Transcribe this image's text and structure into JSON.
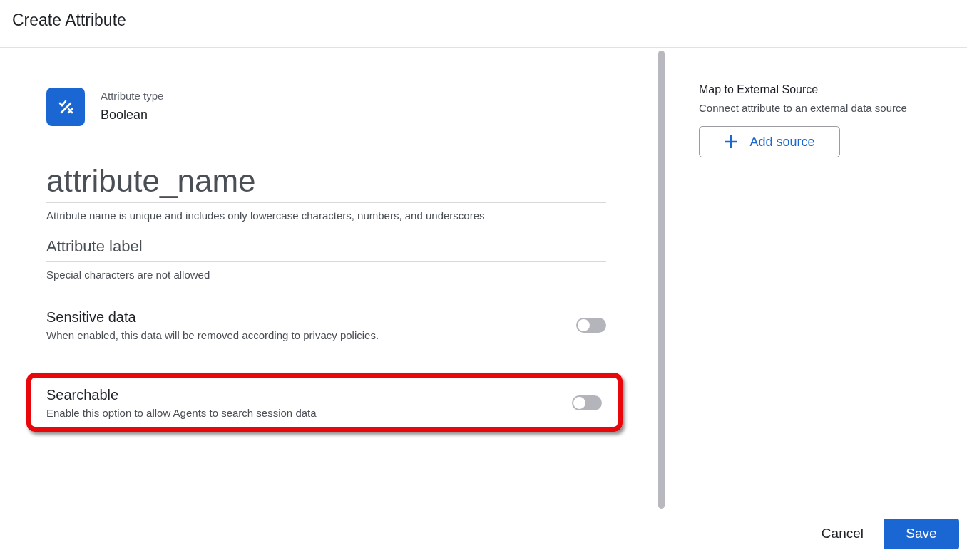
{
  "dialog": {
    "title": "Create Attribute"
  },
  "attribute_type": {
    "label": "Attribute type",
    "value": "Boolean"
  },
  "fields": [
    {
      "kind": "large",
      "placeholder": "attribute_name",
      "hint": "Attribute name is unique and includes only lowercase characters, numbers, and underscores"
    },
    {
      "kind": "normal",
      "placeholder": "Attribute label",
      "hint": "Special characters are not allowed"
    }
  ],
  "toggles": [
    {
      "title": "Sensitive data",
      "description": "When enabled, this data will be removed according to privacy policies.",
      "on": false,
      "highlighted": false
    },
    {
      "title": "Searchable",
      "description": "Enable this option to allow Agents to search session data",
      "on": false,
      "highlighted": true
    }
  ],
  "external_source": {
    "title": "Map to External Source",
    "description": "Connect attribute to an external data source",
    "button": "Add source"
  },
  "footer": {
    "cancel": "Cancel",
    "save": "Save"
  }
}
